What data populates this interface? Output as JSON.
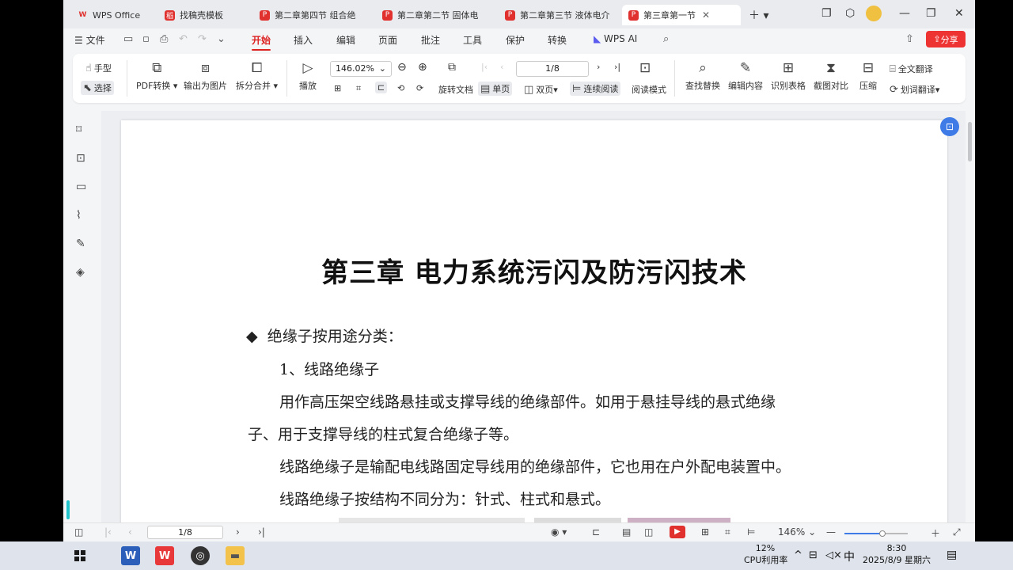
{
  "tabs": [
    {
      "label": "WPS Office",
      "icon": "W",
      "active": false
    },
    {
      "label": "找稿壳模板",
      "icon": "稻",
      "active": false
    },
    {
      "label": "第二章第四节 组合绝",
      "icon": "P",
      "active": false
    },
    {
      "label": "第二章第二节 固体电",
      "icon": "P",
      "active": false
    },
    {
      "label": "第二章第三节 液体电介",
      "icon": "P",
      "active": false
    },
    {
      "label": "第三章第一节",
      "icon": "P",
      "active": true
    }
  ],
  "menu": {
    "file": "文件",
    "items": [
      "开始",
      "插入",
      "编辑",
      "页面",
      "批注",
      "工具",
      "保护",
      "转换"
    ],
    "active": "开始",
    "wps_ai": "WPS AI",
    "share": "分享"
  },
  "ribbon": {
    "hand": "手型",
    "select": "选择",
    "pdf_convert": "PDF转换",
    "export_image": "输出为图片",
    "split_merge": "拆分合并",
    "play": "播放",
    "zoom": "146.02%",
    "page": "1/8",
    "rotate": "旋转文档",
    "single": "单页",
    "double": "双页",
    "continuous": "连续阅读",
    "read_mode": "阅读模式",
    "find_replace": "查找替换",
    "edit_content": "编辑内容",
    "recognize_table": "识别表格",
    "screenshot_compare": "截图对比",
    "compress": "压缩",
    "full_translate": "全文翻译",
    "word_translate": "划词翻译"
  },
  "document": {
    "title": "第三章  电力系统污闪及防污闪技术",
    "bullet": "绝缘子按用途分类：",
    "line1": "1、线路绝缘子",
    "line2a": "用作高压架空线路悬挂或支撑导线的绝缘部件。如用于悬挂导线的悬式绝缘",
    "line2b": "子、用于支撑导线的柱式复合绝缘子等。",
    "line3": "线路绝缘子是输配电线路固定导线用的绝缘部件，它也用在户外配电装置中。",
    "line4": "线路绝缘子按结构不同分为：针式、柱式和悬式。"
  },
  "status": {
    "page": "1/8",
    "zoom": "146%",
    "zoom_fraction": 0.6
  },
  "taskbar": {
    "cpu_percent": "12%",
    "cpu_label": "CPU利用率",
    "ime": "中",
    "time": "8:30",
    "date": "2025/8/9 星期六"
  },
  "colors": {
    "accent": "#d22222",
    "share_bg": "#ee3333",
    "blue": "#3e7be6"
  }
}
